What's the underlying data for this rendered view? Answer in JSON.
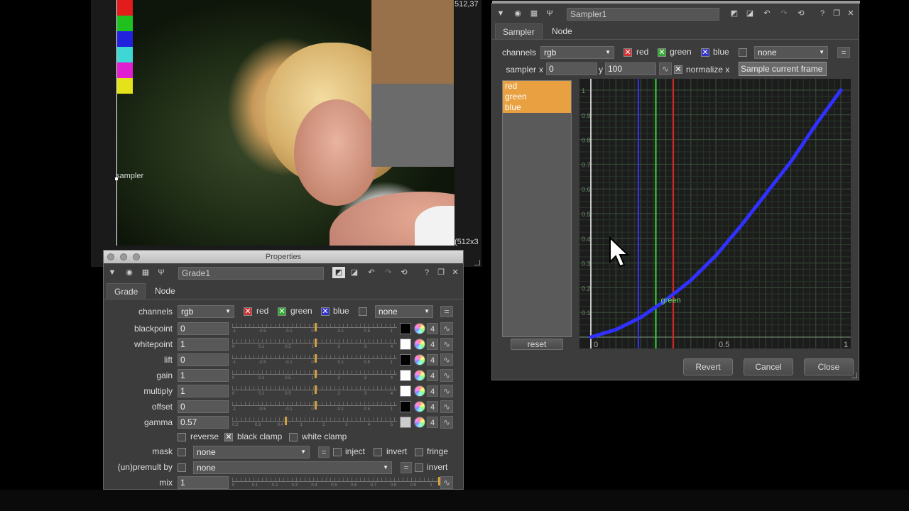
{
  "viewer": {
    "coord_readout": "512,37",
    "format_readout": "(512x3",
    "sampler_label": "sampler"
  },
  "swatches": [
    "#e21b1b",
    "#1fc11f",
    "#2222dd",
    "#3fd6d6",
    "#e01fd0",
    "#e4e21a"
  ],
  "grade_panel": {
    "window_title": "Properties",
    "node_name": "Grade1",
    "tabs": [
      "Grade",
      "Node"
    ],
    "channels_label": "channels",
    "channels_value": "rgb",
    "red": "red",
    "green": "green",
    "blue": "blue",
    "extra_channel": "none",
    "rows": [
      {
        "label": "blackpoint",
        "value": "0",
        "swatch": "#000000",
        "n": "4",
        "ticks": [
          "-1",
          "-0.5",
          "-0.1",
          "0",
          "0.1",
          "0.5",
          "1"
        ],
        "knob": 0.5
      },
      {
        "label": "whitepoint",
        "value": "1",
        "swatch": "#ffffff",
        "n": "4",
        "ticks": [
          "0",
          "0.1",
          "0.5",
          "1",
          "2",
          "3",
          "4"
        ],
        "knob": 0.5
      },
      {
        "label": "lift",
        "value": "0",
        "swatch": "#000000",
        "n": "4",
        "ticks": [
          "-1",
          "-0.5",
          "-0.1",
          "0",
          "0.1",
          "0.5",
          "1"
        ],
        "knob": 0.5
      },
      {
        "label": "gain",
        "value": "1",
        "swatch": "#ffffff",
        "n": "4",
        "ticks": [
          "0",
          "0.1",
          "0.5",
          "1",
          "2",
          "3",
          "4"
        ],
        "knob": 0.5
      },
      {
        "label": "multiply",
        "value": "1",
        "swatch": "#ffffff",
        "n": "4",
        "ticks": [
          "0",
          "0.1",
          "0.5",
          "1",
          "2",
          "3",
          "4"
        ],
        "knob": 0.5
      },
      {
        "label": "offset",
        "value": "0",
        "swatch": "#000000",
        "n": "4",
        "ticks": [
          "-1",
          "-0.5",
          "-0.1",
          "0",
          "0.1",
          "0.5",
          "1"
        ],
        "knob": 0.5
      },
      {
        "label": "gamma",
        "value": "0.57",
        "swatch": "#cccccc",
        "n": "4",
        "ticks": [
          "0.2",
          "0.3",
          "0.4",
          "1",
          "2",
          "3",
          "4",
          "5"
        ],
        "knob": 0.32
      }
    ],
    "reverse": "reverse",
    "black_clamp": "black clamp",
    "white_clamp": "white clamp",
    "mask_label": "mask",
    "mask_value": "none",
    "inject": "inject",
    "invert": "invert",
    "fringe": "fringe",
    "unpremult_label": "(un)premult by",
    "unpremult_value": "none",
    "invert2": "invert",
    "mix_label": "mix",
    "mix_value": "1",
    "mix_ticks": [
      "0",
      "0.1",
      "0.2",
      "0.3",
      "0.4",
      "0.5",
      "0.6",
      "0.7",
      "0.8",
      "0.9",
      "1"
    ]
  },
  "sampler_panel": {
    "node_name": "Sampler1",
    "tabs": [
      "Sampler",
      "Node"
    ],
    "channels_label": "channels",
    "channels_value": "rgb",
    "red": "red",
    "green": "green",
    "blue": "blue",
    "extra_channel": "none",
    "sampler_label": "sampler",
    "x_label": "x",
    "x_value": "0",
    "y_label": "y",
    "y_value": "100",
    "normalize_label": "normalize x",
    "sample_button": "Sample current frame",
    "channel_list": [
      "red",
      "green",
      "blue"
    ],
    "reset_button": "reset",
    "revert_button": "Revert",
    "cancel_button": "Cancel",
    "close_button": "Close",
    "curve_label": "green"
  },
  "chart_data": {
    "type": "line",
    "xlim": [
      0,
      1
    ],
    "ylim": [
      0,
      1
    ],
    "x_ticks": [
      "0",
      "0.5",
      "1"
    ],
    "y_ticks": [
      "0.1",
      "0.2",
      "0.3",
      "0.4",
      "0.5",
      "0.6",
      "0.7",
      "0.8",
      "0.9",
      "1"
    ],
    "vertical_markers": [
      {
        "name": "blue",
        "x": 0.19,
        "color": "#3333ff"
      },
      {
        "name": "green",
        "x": 0.26,
        "color": "#33dd33"
      },
      {
        "name": "red",
        "x": 0.33,
        "color": "#dd2222"
      }
    ],
    "series": [
      {
        "name": "green",
        "color": "#3030ff",
        "x": [
          0,
          0.1,
          0.2,
          0.3,
          0.4,
          0.5,
          0.6,
          0.7,
          0.8,
          0.9,
          1.0
        ],
        "y": [
          0,
          0.03,
          0.08,
          0.15,
          0.23,
          0.33,
          0.45,
          0.58,
          0.71,
          0.86,
          1.0
        ]
      }
    ]
  }
}
